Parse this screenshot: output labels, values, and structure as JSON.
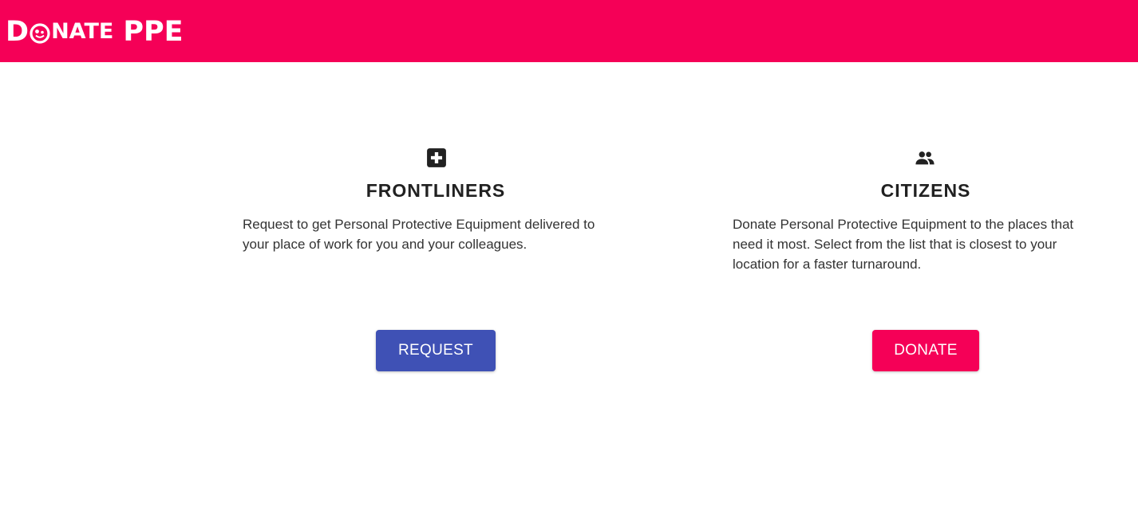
{
  "header": {
    "logo": {
      "letter_d": "D",
      "rest": "NATE",
      "ppe": "PPE",
      "icon": "donate-heart-logo-icon"
    },
    "background_color": "#f50057"
  },
  "sections": {
    "frontliners": {
      "icon": "medical-cross-icon",
      "title": "FRONTLINERS",
      "description": "Request to get Personal Protective Equipment delivered to your place of work for you and your colleagues.",
      "button_label": "REQUEST",
      "button_color": "#3f51b5"
    },
    "citizens": {
      "icon": "people-group-icon",
      "title": "CITIZENS",
      "description": "Donate Personal Protective Equipment to the places that need it most. Select from the list that is closest to your location for a faster turnaround.",
      "button_label": "DONATE",
      "button_color": "#f50057"
    }
  }
}
